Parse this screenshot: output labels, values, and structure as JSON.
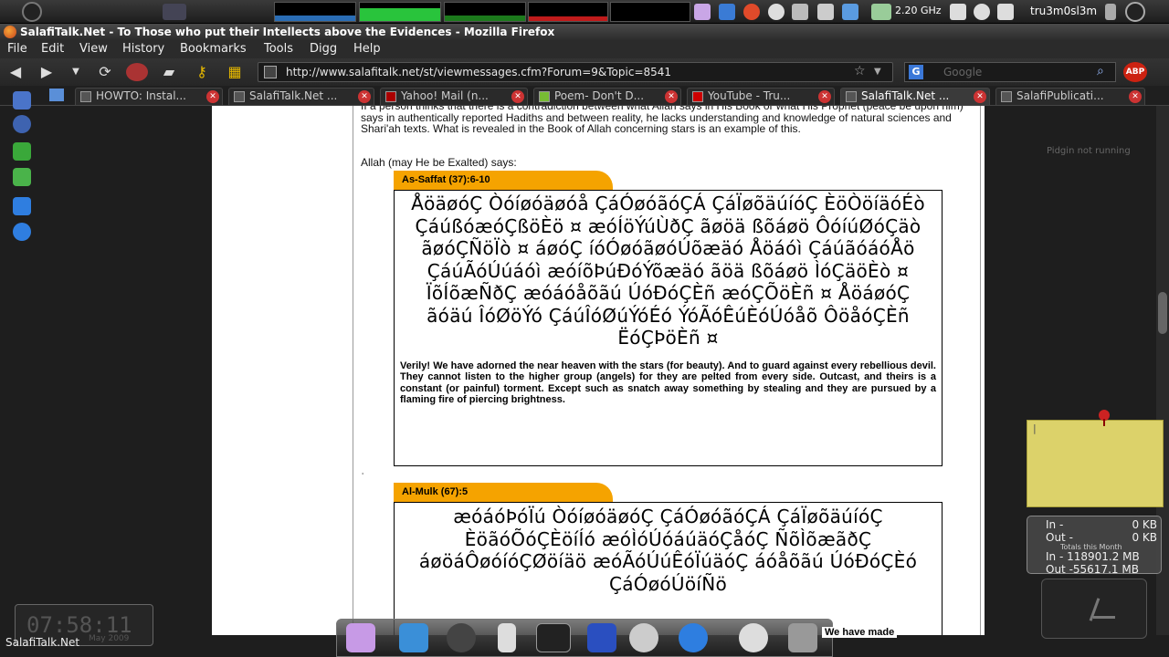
{
  "top_panel": {
    "cpu_freq": "2.20 GHz",
    "user": "tru3m0sl3m"
  },
  "window": {
    "title": "SalafiTalk.Net - To Those who put their Intellects above the Evidences - Mozilla Firefox"
  },
  "menu": {
    "items": [
      "File",
      "Edit",
      "View",
      "History",
      "Bookmarks",
      "Tools",
      "Digg",
      "Help"
    ]
  },
  "navbar": {
    "url": "http://www.salafitalk.net/st/viewmessages.cfm?Forum=9&Topic=8541",
    "search_placeholder": "Google",
    "abp_label": "ABP"
  },
  "tabs": [
    {
      "label": "HOWTO: Instal..."
    },
    {
      "label": "SalafiTalk.Net ..."
    },
    {
      "label": "Yahoo! Mail (n..."
    },
    {
      "label": "Poem- Don't D..."
    },
    {
      "label": "YouTube - Tru..."
    },
    {
      "label": "SalafiTalk.Net ..."
    },
    {
      "label": "SalafiPublicati..."
    }
  ],
  "page": {
    "intro": "If a person thinks that there is a contradiction between what Allah says in His Book or what His Prophet (peace be upon him) says in authentically reported Hadiths and between reality, he lacks understanding and knowledge of natural sciences and Shari'ah texts. What is revealed in the Book of Allah concerning stars is an example of this.",
    "allah_says": "Allah (may He be Exalted) says:",
    "verse1": {
      "ref": "As-Saffat (37):6-10",
      "arabic": "ÅöäøóÇ Òóíøóäøóå ÇáÓøóãóÇÁ ÇáÏøõäúíóÇ ÈöÒöíäóÉò ÇáúßóæóÇßöÈö ¤ æóÍöÝúÙðÇ ãøöä ßõáøö ÔóíúØóÇäò ãøóÇÑöÏò ¤ áøóÇ íóÓøóãøóÚõæäó Åöáóì ÇáúãóáóÅö ÇáúÃóÚúáóì æóíõÞúÐóÝõæäó ãöä ßõáøö ÌóÇäöÈò ¤ ÏõÍõæÑðÇ æóáóåõãú ÚóÐóÇÈñ æóÇÕöÈñ ¤ ÅöáøóÇ ãóäú ÎóØöÝó ÇáúÎóØúÝóÉó ÝóÃóÊúÈóÚóåõ ÔöåóÇÈñ ËóÇÞöÈñ ¤",
      "translation": "Verily! We have adorned the near heaven with the stars (for beauty). And to guard against every rebellious devil. They cannot listen to the higher group (angels) for they are pelted from every side. Outcast, and theirs is a constant (or painful) torment. Except such as snatch away something by stealing and they are pursued by a flaming fire of piercing brightness."
    },
    "stray_mark": "'",
    "verse2": {
      "ref": "Al-Mulk (67):5",
      "arabic": "æóáóÞóÏú ÒóíøóäøóÇ ÇáÓøóãóÇÁ ÇáÏøõäúíóÇ ÈöãóÕóÇÈöíÍó æóÌóÚóáúäóÇåóÇ ÑõÌõæãðÇ áøöáÔøóíóÇØöíäö æóÃóÚúÊóÏúäóÇ áóåõãú ÚóÐóÇÈó ÇáÓøóÚöíÑö",
      "translation_fragment": "We have made"
    }
  },
  "widgets": {
    "pidgin_status": "Pidgin not running",
    "net": {
      "in_label": "In -",
      "in_value": "0 KB",
      "out_label": "Out -",
      "out_value": "0 KB",
      "subtitle": "Totals this Month",
      "in_total": "In - 118901.2 MB",
      "out_total": "Out -55617.1 MB"
    },
    "desk_clock": {
      "time": "07:58:11",
      "date": "May 2009"
    },
    "statusbar_text": "SalafiTalk.Net"
  }
}
